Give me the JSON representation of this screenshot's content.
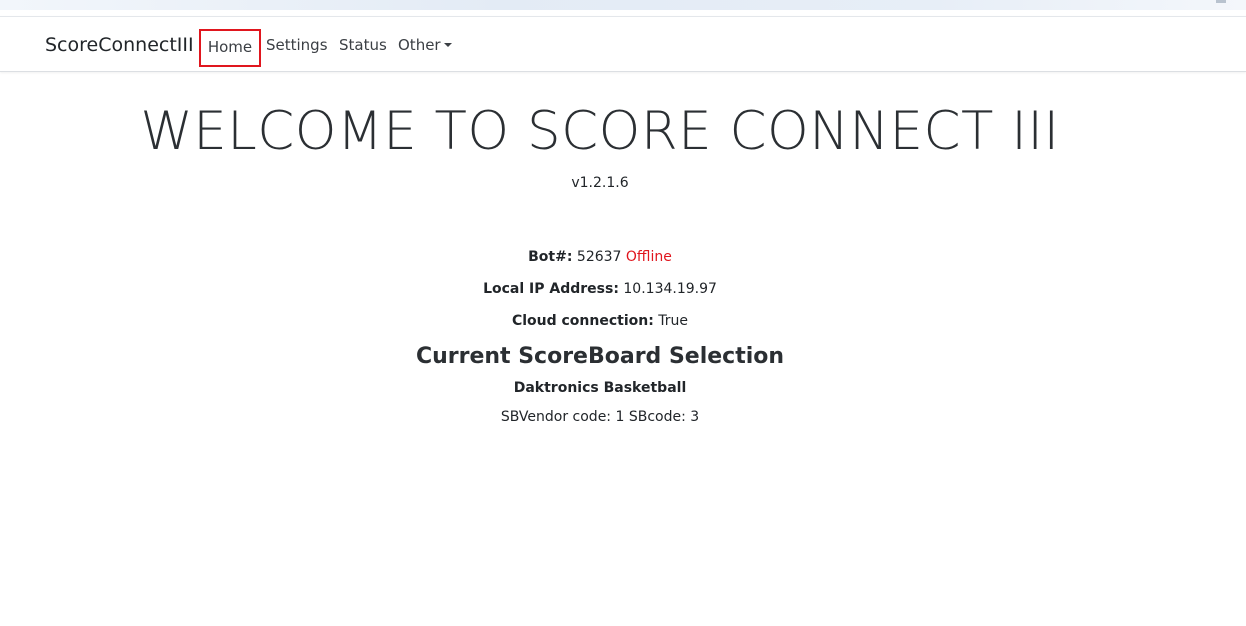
{
  "nav": {
    "brand": "ScoreConnectIII",
    "items": [
      {
        "label": "Home",
        "active": true
      },
      {
        "label": "Settings"
      },
      {
        "label": "Status"
      },
      {
        "label": "Other"
      }
    ]
  },
  "main": {
    "title": "WELCOME TO SCORE CONNECT III",
    "version": "v1.2.1.6",
    "bot": {
      "label": "Bot#:",
      "value": "52637",
      "status": "Offline"
    },
    "ip": {
      "label": "Local IP Address:",
      "value": "10.134.19.97"
    },
    "cloud": {
      "label": "Cloud connection:",
      "value": "True"
    },
    "scoreboard": {
      "heading": "Current ScoreBoard Selection",
      "name": "Daktronics Basketball",
      "codes": "SBVendor code: 1 SBcode: 3"
    }
  },
  "colors": {
    "status_offline": "#e0161e",
    "highlight_border": "#e0161e"
  }
}
